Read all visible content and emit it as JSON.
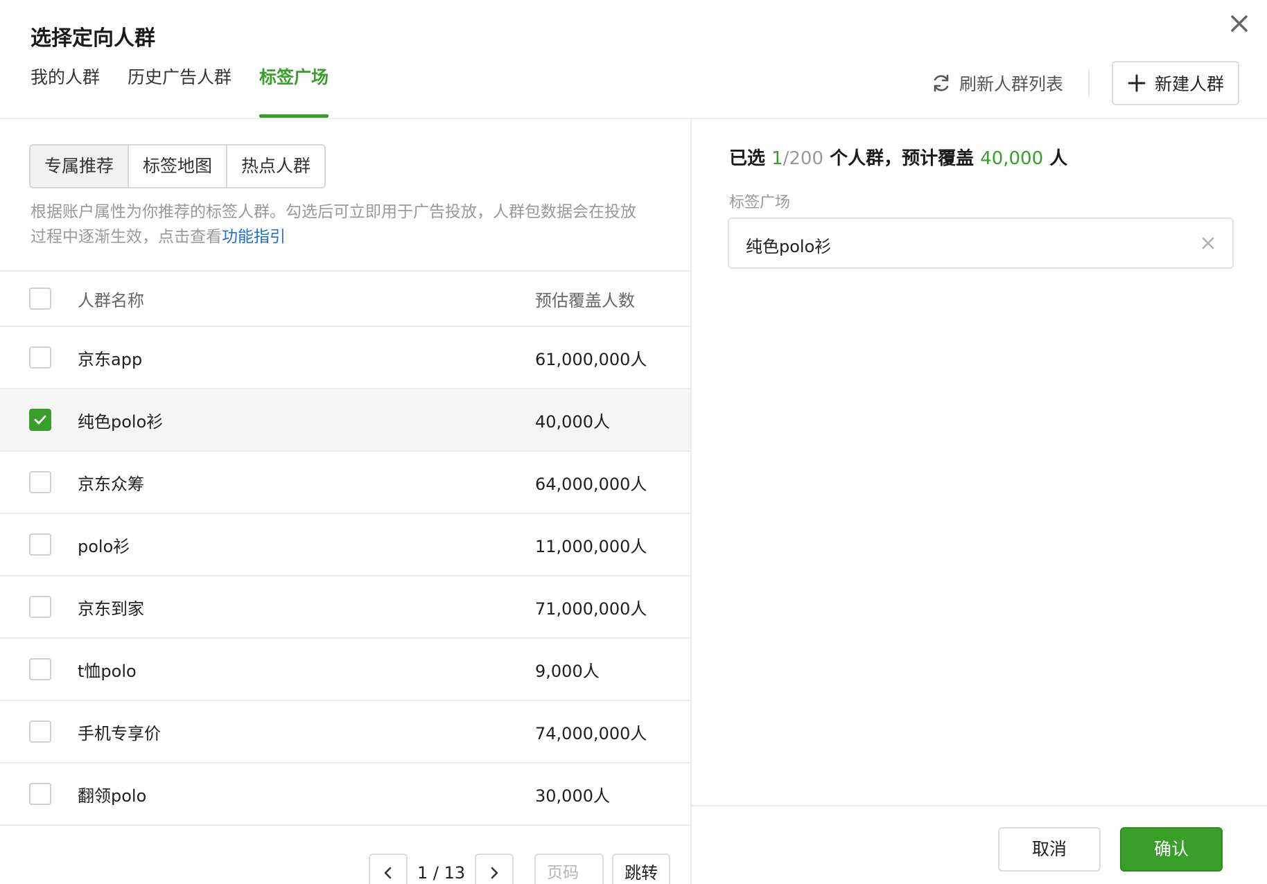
{
  "dialog": {
    "title": "选择定向人群",
    "tabs": [
      {
        "label": "我的人群"
      },
      {
        "label": "历史广告人群"
      },
      {
        "label": "标签广场",
        "active": true
      }
    ],
    "refresh_label": "刷新人群列表",
    "new_label": "新建人群"
  },
  "left": {
    "segments": [
      {
        "label": "专属推荐",
        "active": true
      },
      {
        "label": "标签地图"
      },
      {
        "label": "热点人群"
      }
    ],
    "description": "根据账户属性为你推荐的标签人群。勾选后可立即用于广告投放，人群包数据会在投放过程中逐渐生效，点击查看",
    "description_link": "功能指引",
    "table": {
      "header_name": "人群名称",
      "header_count": "预估覆盖人数",
      "rows": [
        {
          "name": "京东app",
          "count": "61,000,000人",
          "checked": false
        },
        {
          "name": "纯色polo衫",
          "count": "40,000人",
          "checked": true
        },
        {
          "name": "京东众筹",
          "count": "64,000,000人",
          "checked": false
        },
        {
          "name": "polo衫",
          "count": "11,000,000人",
          "checked": false
        },
        {
          "name": "京东到家",
          "count": "71,000,000人",
          "checked": false
        },
        {
          "name": "t恤polo",
          "count": "9,000人",
          "checked": false
        },
        {
          "name": "手机专享价",
          "count": "74,000,000人",
          "checked": false
        },
        {
          "name": "翻领polo",
          "count": "30,000人",
          "checked": false
        }
      ]
    },
    "pagination": {
      "page_text": "1 / 13",
      "input_placeholder": "页码",
      "jump_label": "跳转"
    }
  },
  "right": {
    "summary_prefix": "已选",
    "selected": "1",
    "limit": "/200",
    "summary_middle": "个人群，预计覆盖",
    "coverage": "40,000",
    "summary_suffix": "人",
    "group_label": "标签广场",
    "selected_item": "纯色polo衫",
    "cancel_label": "取消",
    "confirm_label": "确认"
  },
  "colors": {
    "accent": "#3a9e2b",
    "link": "#1f6fd0"
  }
}
